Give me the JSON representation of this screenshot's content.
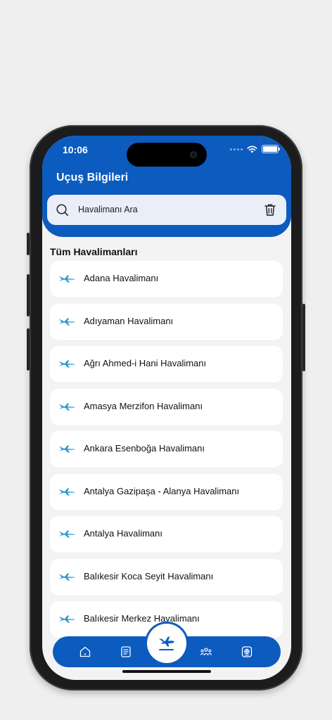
{
  "status_bar": {
    "time": "10:06"
  },
  "header": {
    "title": "Uçuş Bilgileri"
  },
  "search": {
    "placeholder": "Havalimanı Ara",
    "value": ""
  },
  "section": {
    "title": "Tüm Havalimanları"
  },
  "airports": [
    "Adana Havalimanı",
    "Adıyaman Havalimanı",
    "Ağrı Ahmed-i Hani Havalimanı",
    "Amasya Merzifon Havalimanı",
    "Ankara Esenboğa Havalimanı",
    "Antalya Gazipaşa - Alanya Havalimanı",
    "Antalya Havalimanı",
    "Balıkesir Koca Seyit Havalimanı",
    "Balıkesir Merkez Havalimanı"
  ],
  "tabbar": {
    "tabs": [
      "home-icon",
      "document-icon",
      "flight-departure-icon",
      "people-group-icon",
      "passport-icon"
    ],
    "active": "flight-departure-icon"
  },
  "colors": {
    "primary": "#0c5bbf",
    "search_bg": "#e9eef8",
    "plane_icon": "#1a96c9"
  }
}
